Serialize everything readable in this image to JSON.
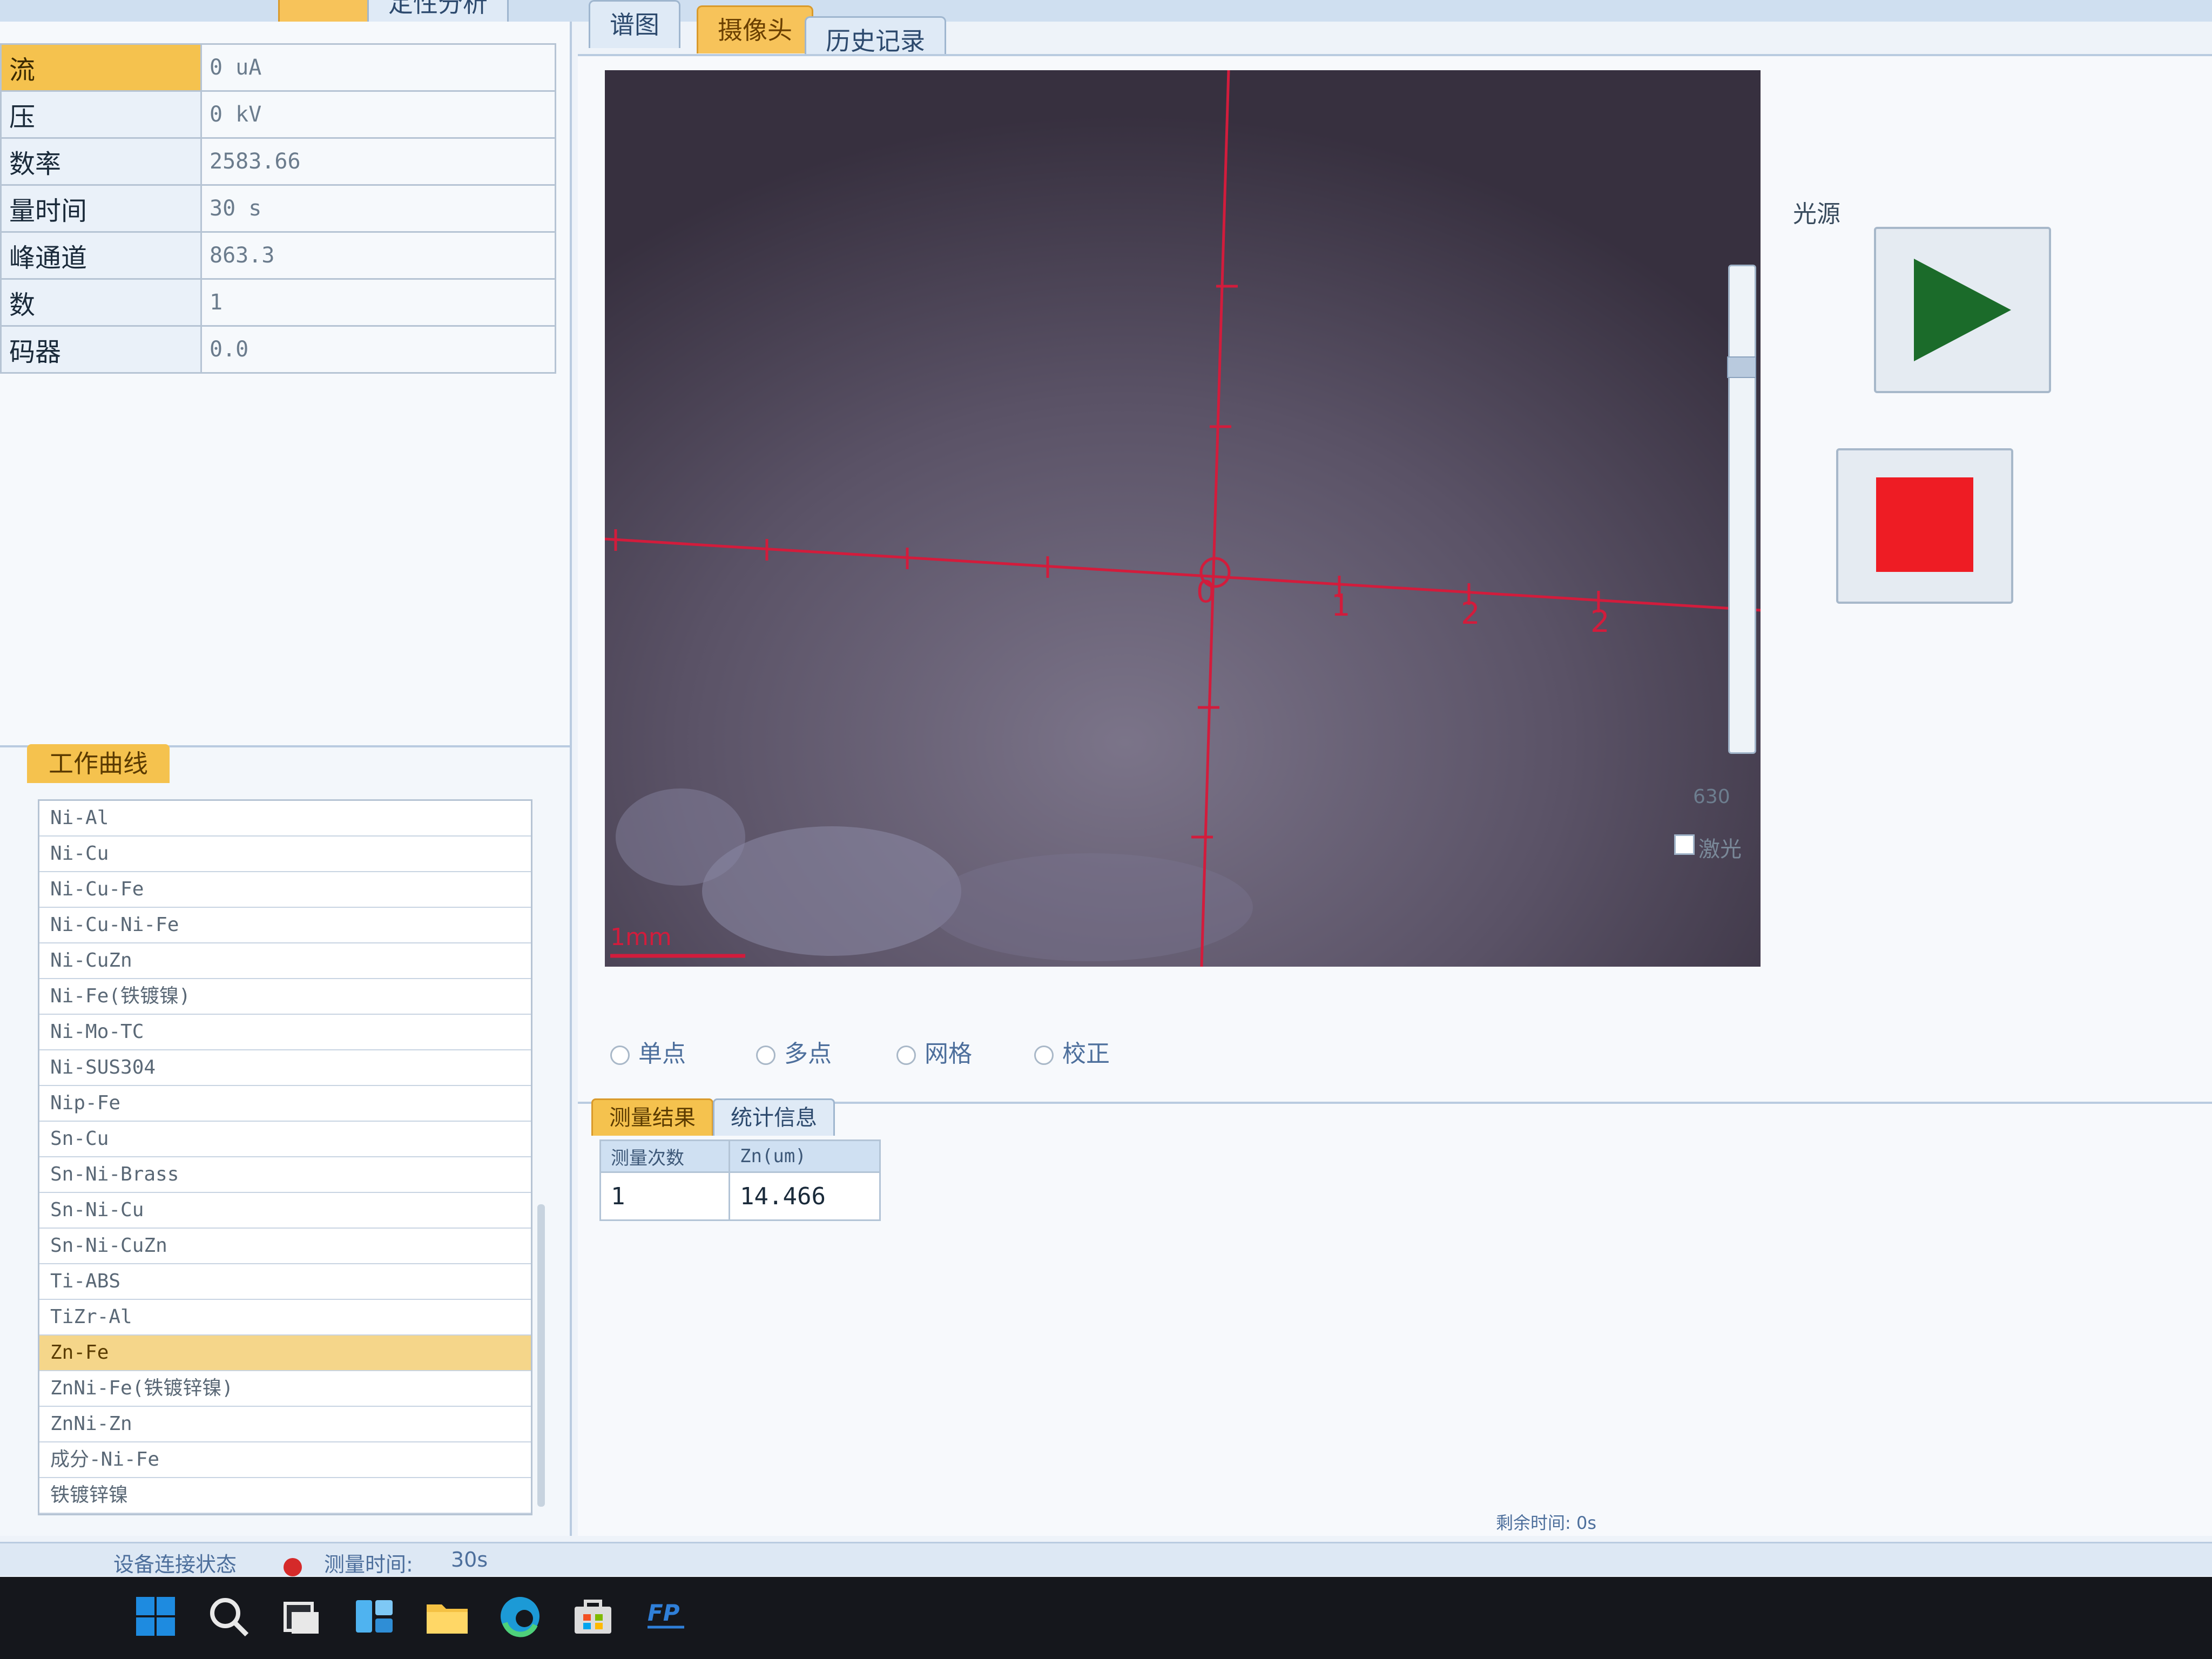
{
  "top_tabs": {
    "left_orange": "",
    "fixed_analysis": "定性分析"
  },
  "camera_tabs": [
    "谱图",
    "摄像头",
    "历史记录"
  ],
  "params": [
    {
      "label": "流",
      "value": "0 uA"
    },
    {
      "label": "压",
      "value": "0 kV"
    },
    {
      "label": "数率",
      "value": "2583.66"
    },
    {
      "label": "量时间",
      "value": "30 s"
    },
    {
      "label": "峰通道",
      "value": "863.3"
    },
    {
      "label": "数",
      "value": "1"
    },
    {
      "label": "码器",
      "value": "0.0"
    }
  ],
  "curve_panel": {
    "tab": "工作曲线",
    "items": [
      "Ni-Al",
      "Ni-Cu",
      "Ni-Cu-Fe",
      "Ni-Cu-Ni-Fe",
      "Ni-CuZn",
      "Ni-Fe(铁镀镍)",
      "Ni-Mo-TC",
      "Ni-SUS304",
      "Nip-Fe",
      "Sn-Cu",
      "Sn-Ni-Brass",
      "Sn-Ni-Cu",
      "Sn-Ni-CuZn",
      "Ti-ABS",
      "TiZr-Al",
      "Zn-Fe",
      "ZnNi-Fe(铁镀锌镍)",
      "ZnNi-Zn",
      "成分-Ni-Fe",
      "铁镀锌镍"
    ],
    "selected_index": 15
  },
  "camera": {
    "axis_labels": [
      "0",
      "1",
      "2",
      "2"
    ],
    "scale_bar": "1mm"
  },
  "light_source": {
    "label": "光源",
    "value": "630",
    "laser_label": "激光"
  },
  "modes": [
    "单点",
    "多点",
    "网格",
    "校正"
  ],
  "result_tabs": [
    "测量结果",
    "统计信息"
  ],
  "results": {
    "headers": [
      "测量次数",
      "Zn(um)"
    ],
    "rows": [
      [
        "1",
        "14.466"
      ]
    ]
  },
  "status": {
    "connection": "设备连接状态",
    "measure_time_label": "测量时间:",
    "measure_time_value": "30s",
    "remaining": "剩余时间: 0s"
  },
  "colors": {
    "accent": "#f5c24e",
    "crosshair": "#d21c3c",
    "play": "#1b6b2a",
    "stop": "#ee1c24"
  },
  "taskbar_icons": [
    "windows-icon",
    "search-icon",
    "task-view-icon",
    "widgets-icon",
    "file-explorer-icon",
    "edge-icon",
    "store-icon",
    "fp-app-icon"
  ]
}
